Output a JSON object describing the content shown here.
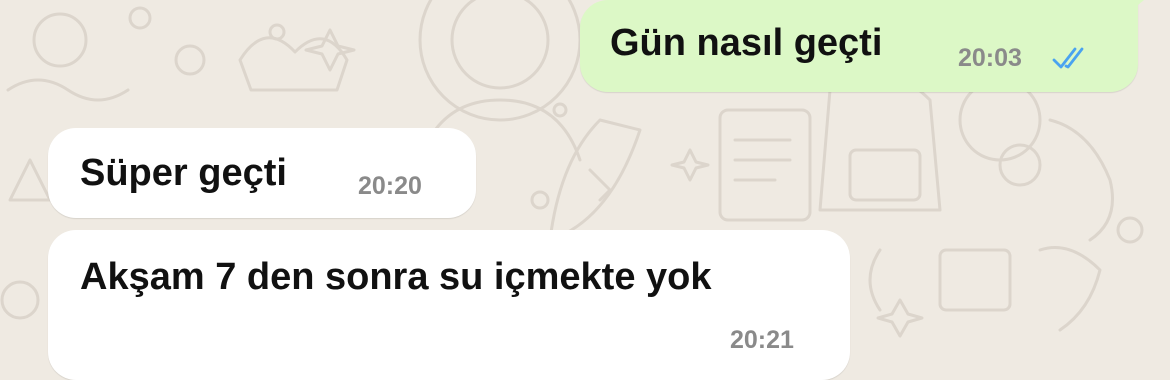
{
  "messages": [
    {
      "direction": "outgoing",
      "text": "Gün nasıl geçti",
      "time": "20:03",
      "status": "read"
    },
    {
      "direction": "incoming",
      "text": "Süper geçti",
      "time": "20:20"
    },
    {
      "direction": "incoming",
      "text": "Akşam 7 den sonra su içmekte yok",
      "time": "20:21"
    }
  ],
  "colors": {
    "wallpaper": "#efeae2",
    "outgoing_bubble": "#dcf8c6",
    "incoming_bubble": "#ffffff",
    "read_ticks": "#4aa3f0"
  },
  "icons": {
    "status": "double-check-icon"
  }
}
